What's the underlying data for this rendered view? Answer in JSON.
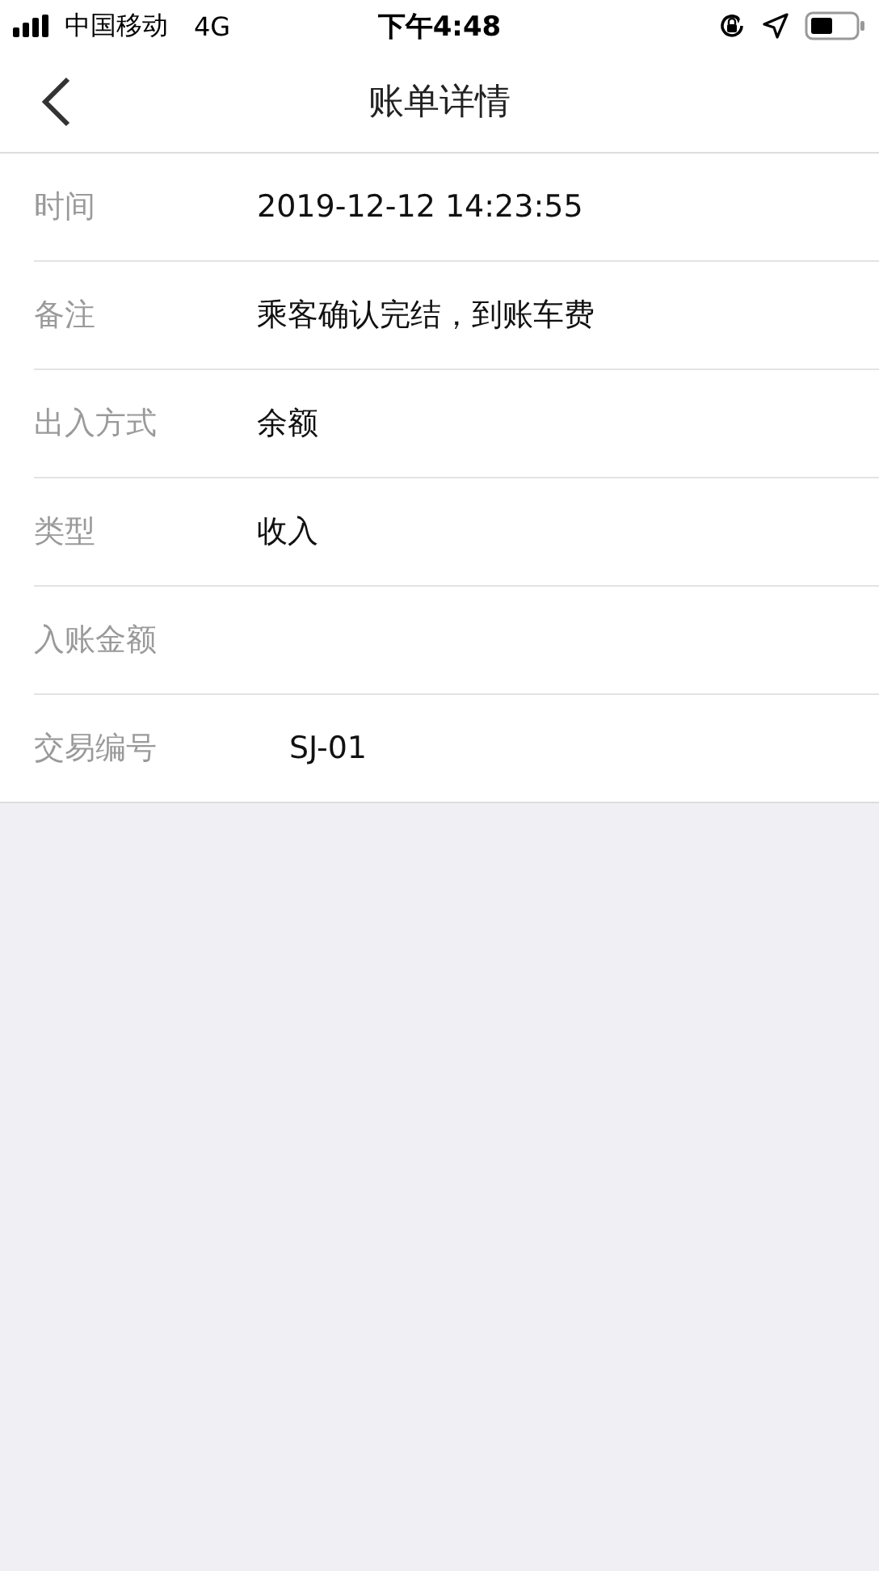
{
  "status_bar": {
    "carrier": "中国移动",
    "network": "4G",
    "time": "下午4:48"
  },
  "nav": {
    "title": "账单详情"
  },
  "rows": [
    {
      "label": "时间",
      "value": "2019-12-12 14:23:55"
    },
    {
      "label": "备注",
      "value": "乘客确认完结，到账车费"
    },
    {
      "label": "出入方式",
      "value": "余额"
    },
    {
      "label": "类型",
      "value": "收入"
    },
    {
      "label": "入账金额"
    },
    {
      "label": "交易编号",
      "value": "SJ-01"
    }
  ]
}
